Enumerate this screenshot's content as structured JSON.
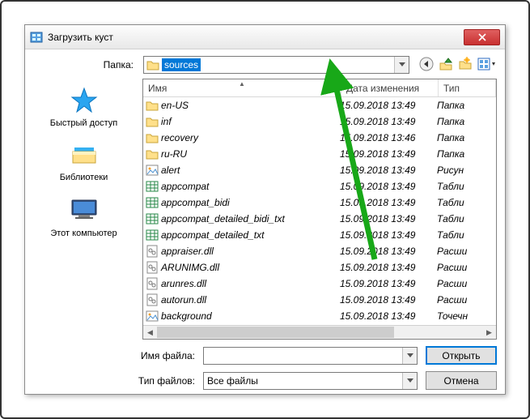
{
  "window": {
    "title": "Загрузить куст"
  },
  "toolbar": {
    "folder_label": "Папка:",
    "folder_value": "sources"
  },
  "places": {
    "quick": "Быстрый доступ",
    "libs": "Библиотеки",
    "pc": "Этот компьютер"
  },
  "columns": {
    "name": "Имя",
    "date": "Дата изменения",
    "type": "Тип"
  },
  "files": [
    {
      "icon": "folder",
      "name": "en-US",
      "date": "15.09.2018 13:49",
      "type": "Папка"
    },
    {
      "icon": "folder",
      "name": "inf",
      "date": "15.09.2018 13:49",
      "type": "Папка"
    },
    {
      "icon": "folder",
      "name": "recovery",
      "date": "15.09.2018 13:46",
      "type": "Папка"
    },
    {
      "icon": "folder",
      "name": "ru-RU",
      "date": "15.09.2018 13:49",
      "type": "Папка"
    },
    {
      "icon": "image",
      "name": "alert",
      "date": "15.09.2018 13:49",
      "type": "Рисун"
    },
    {
      "icon": "table",
      "name": "appcompat",
      "date": "15.09.2018 13:49",
      "type": "Табли"
    },
    {
      "icon": "table",
      "name": "appcompat_bidi",
      "date": "15.09.2018 13:49",
      "type": "Табли"
    },
    {
      "icon": "table",
      "name": "appcompat_detailed_bidi_txt",
      "date": "15.09.2018 13:49",
      "type": "Табли"
    },
    {
      "icon": "table",
      "name": "appcompat_detailed_txt",
      "date": "15.09.2018 13:49",
      "type": "Табли"
    },
    {
      "icon": "dll",
      "name": "appraiser.dll",
      "date": "15.09.2018 13:49",
      "type": "Расши"
    },
    {
      "icon": "dll",
      "name": "ARUNIMG.dll",
      "date": "15.09.2018 13:49",
      "type": "Расши"
    },
    {
      "icon": "dll",
      "name": "arunres.dll",
      "date": "15.09.2018 13:49",
      "type": "Расши"
    },
    {
      "icon": "dll",
      "name": "autorun.dll",
      "date": "15.09.2018 13:49",
      "type": "Расши"
    },
    {
      "icon": "image",
      "name": "background",
      "date": "15.09.2018 13:49",
      "type": "Точечн"
    }
  ],
  "bottom": {
    "filename_label": "Имя файла:",
    "filetype_label": "Тип файлов:",
    "filetype_value": "Все файлы",
    "open": "Открыть",
    "cancel": "Отмена"
  }
}
